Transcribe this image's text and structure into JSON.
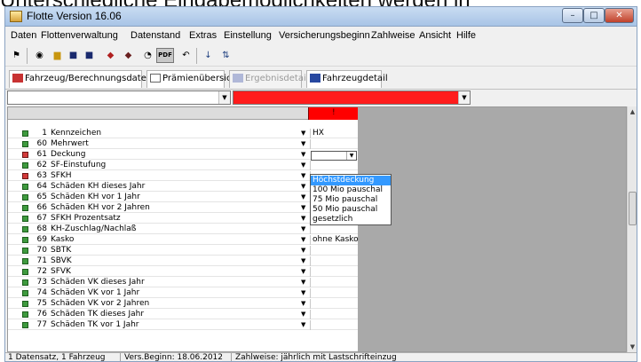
{
  "headline": "Unterschiedliche Eingabemöglichkeiten werden in",
  "window": {
    "title": "Flotte Version 16.06",
    "min_glyph": "–",
    "max_glyph": "□",
    "close_glyph": "✕"
  },
  "menu": [
    "Daten",
    "Flottenverwaltung",
    "Datenstand",
    "Extras",
    "Einstellung",
    "Versicherungsbeginn",
    "Zahlweise",
    "Ansicht",
    "Hilfe"
  ],
  "toolbar": {
    "pdf_label": "PDF"
  },
  "tabs": [
    "Fahrzeug/Berechnungsdaten",
    "Prämienübersicht",
    "Ergebnisdetail",
    "Fahrzeugdetail"
  ],
  "grid": {
    "header_marker": "!",
    "rows": [
      {
        "status": "green",
        "num": "1",
        "label": "Kennzeichen",
        "value": "HX"
      },
      {
        "status": "green",
        "num": "60",
        "label": "Mehrwert",
        "value": ""
      },
      {
        "status": "red",
        "num": "61",
        "label": "Deckung",
        "value": ""
      },
      {
        "status": "green",
        "num": "62",
        "label": "SF-Einstufung",
        "value": ""
      },
      {
        "status": "red",
        "num": "63",
        "label": "SFKH",
        "value": ""
      },
      {
        "status": "green",
        "num": "64",
        "label": "Schäden KH dieses Jahr",
        "value": ""
      },
      {
        "status": "green",
        "num": "65",
        "label": "Schäden KH vor 1 Jahr",
        "value": ""
      },
      {
        "status": "green",
        "num": "66",
        "label": "Schäden KH vor 2 Jahren",
        "value": ""
      },
      {
        "status": "green",
        "num": "67",
        "label": "SFKH Prozentsatz",
        "value": ""
      },
      {
        "status": "green",
        "num": "68",
        "label": "KH-Zuschlag/Nachlaß",
        "value": ""
      },
      {
        "status": "green",
        "num": "69",
        "label": "Kasko",
        "value": "ohne Kasko"
      },
      {
        "status": "green",
        "num": "70",
        "label": "SBTK",
        "value": ""
      },
      {
        "status": "green",
        "num": "71",
        "label": "SBVK",
        "value": ""
      },
      {
        "status": "green",
        "num": "72",
        "label": "SFVK",
        "value": ""
      },
      {
        "status": "green",
        "num": "73",
        "label": "Schäden VK dieses Jahr",
        "value": ""
      },
      {
        "status": "green",
        "num": "74",
        "label": "Schäden VK vor 1 Jahr",
        "value": ""
      },
      {
        "status": "green",
        "num": "75",
        "label": "Schäden VK vor 2 Jahren",
        "value": ""
      },
      {
        "status": "green",
        "num": "76",
        "label": "Schäden TK dieses Jahr",
        "value": ""
      },
      {
        "status": "green",
        "num": "77",
        "label": "Schäden TK vor 1 Jahr",
        "value": ""
      }
    ]
  },
  "dropdown": {
    "options": [
      "Höchstdeckung",
      "100 Mio pauschal",
      "75 Mio pauschal",
      "50 Mio pauschal",
      "gesetzlich"
    ],
    "selected_index": 0
  },
  "statusbar": {
    "records": "1 Datensatz, 1 Fahrzeug",
    "begin": "Vers.Beginn: 18.06.2012",
    "payment": "Zahlweise: jährlich mit Lastschrifteinzug"
  },
  "colors": {
    "status_green": "#3e9a3e",
    "status_red": "#d23a3a",
    "highlight_red": "#ff1c1c",
    "selection_blue": "#3399ff"
  }
}
